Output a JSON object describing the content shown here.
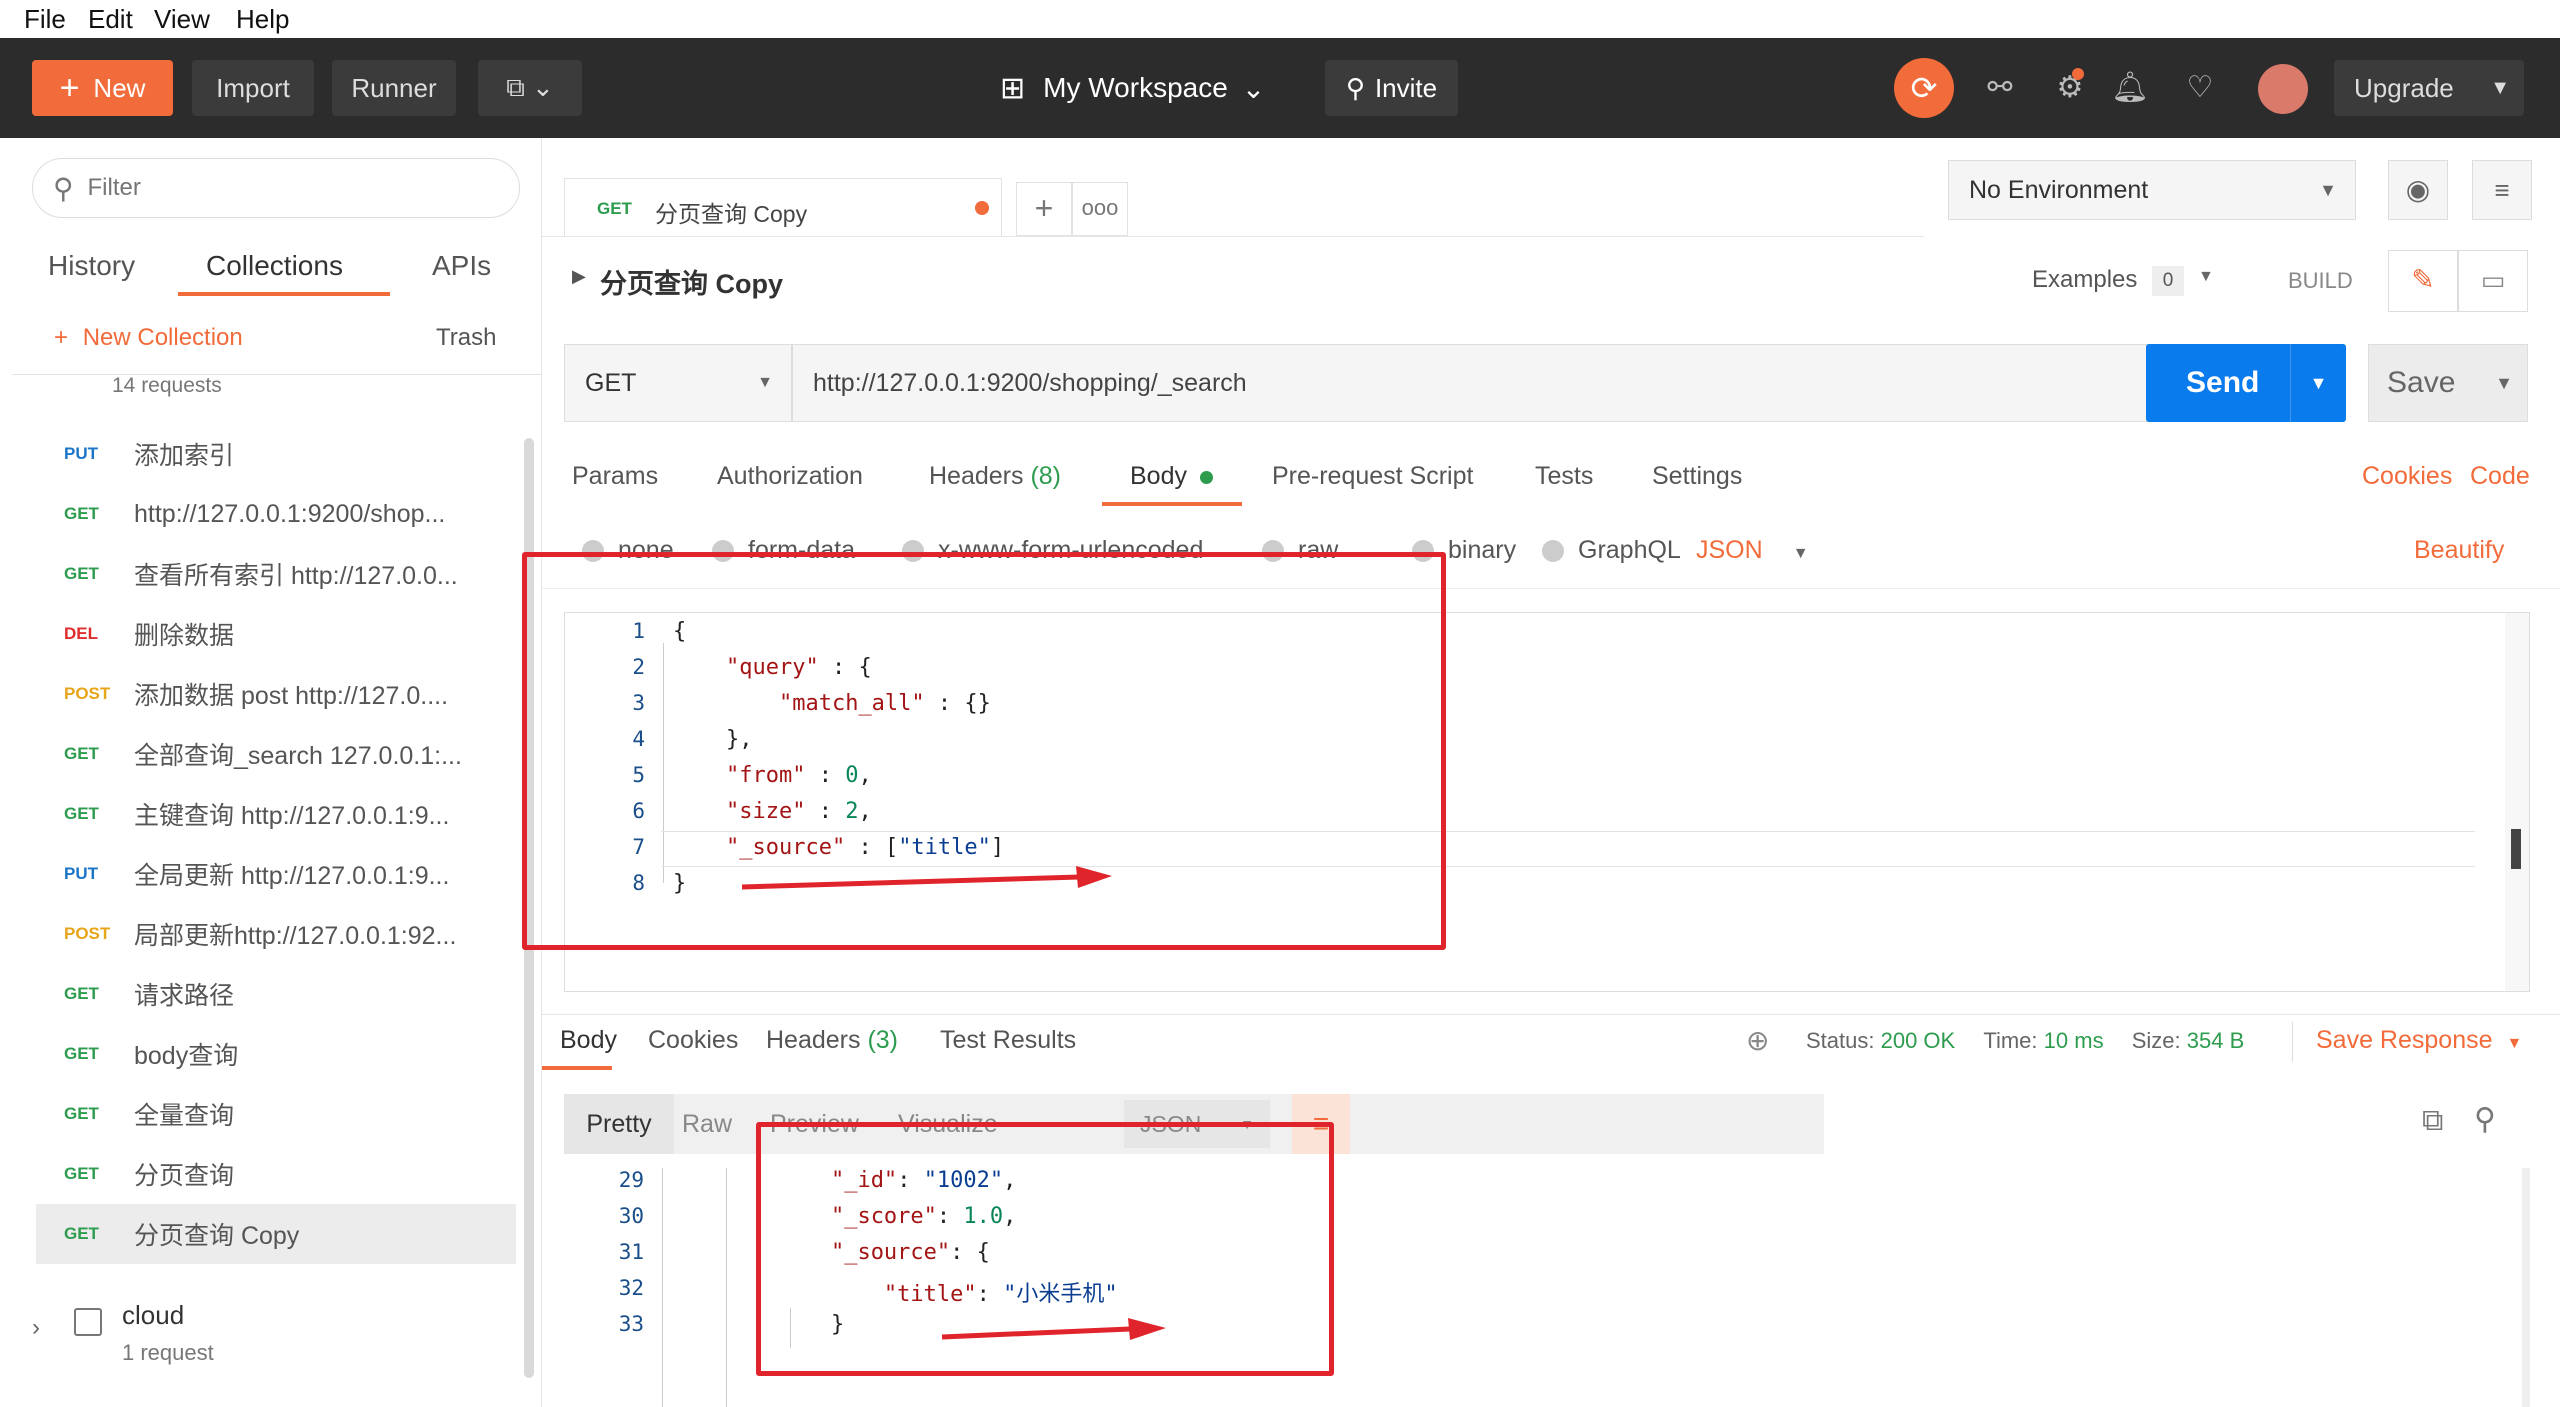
{
  "menu": [
    "File",
    "Edit",
    "View",
    "Help"
  ],
  "header": {
    "new_label": "New",
    "import_label": "Import",
    "runner_label": "Runner",
    "workspace_label": "My Workspace",
    "invite_label": "Invite",
    "upgrade_label": "Upgrade"
  },
  "sidebar": {
    "filter_placeholder": "Filter",
    "tabs": [
      "History",
      "Collections",
      "APIs"
    ],
    "new_collection": "New Collection",
    "trash": "Trash",
    "collection_count": "14 requests",
    "items": [
      {
        "method": "PUT",
        "label": "添加索引"
      },
      {
        "method": "GET",
        "label": "http://127.0.0.1:9200/shop..."
      },
      {
        "method": "GET",
        "label": "查看所有索引 http://127.0.0..."
      },
      {
        "method": "DEL",
        "label": "删除数据"
      },
      {
        "method": "POST",
        "label": "添加数据 post http://127.0...."
      },
      {
        "method": "GET",
        "label": "全部查询_search 127.0.0.1:..."
      },
      {
        "method": "GET",
        "label": "主键查询 http://127.0.0.1:9..."
      },
      {
        "method": "PUT",
        "label": "全局更新 http://127.0.0.1:9..."
      },
      {
        "method": "POST",
        "label": "局部更新http://127.0.0.1:92..."
      },
      {
        "method": "GET",
        "label": "请求路径"
      },
      {
        "method": "GET",
        "label": "body查询"
      },
      {
        "method": "GET",
        "label": "全量查询"
      },
      {
        "method": "GET",
        "label": "分页查询"
      },
      {
        "method": "GET",
        "label": "分页查询 Copy"
      }
    ],
    "cloud_name": "cloud",
    "cloud_count": "1 request"
  },
  "tab": {
    "method": "GET",
    "name": "分页查询 Copy"
  },
  "environment": "No Environment",
  "request": {
    "title": "分页查询 Copy",
    "examples_label": "Examples",
    "examples_count": "0",
    "build_label": "BUILD",
    "method": "GET",
    "url": "http://127.0.0.1:9200/shopping/_search",
    "send": "Send",
    "save": "Save",
    "tabs": [
      "Params",
      "Authorization",
      "Headers",
      "Body",
      "Pre-request Script",
      "Tests",
      "Settings"
    ],
    "headers_count": "(8)",
    "cookies": "Cookies",
    "code": "Code",
    "body_types": [
      "none",
      "form-data",
      "x-www-form-urlencoded",
      "raw",
      "binary",
      "GraphQL"
    ],
    "json_label": "JSON",
    "beautify": "Beautify",
    "body_lines": [
      {
        "n": "1",
        "t": "{"
      },
      {
        "n": "2",
        "t": "    \"query\" : {"
      },
      {
        "n": "3",
        "t": "        \"match_all\" : {}"
      },
      {
        "n": "4",
        "t": "    },"
      },
      {
        "n": "5",
        "t": "    \"from\" : 0,"
      },
      {
        "n": "6",
        "t": "    \"size\" : 2,"
      },
      {
        "n": "7",
        "t": "    \"_source\" : [\"title\"]"
      },
      {
        "n": "8",
        "t": "}"
      }
    ]
  },
  "response": {
    "tabs": [
      "Body",
      "Cookies",
      "Headers",
      "Test Results"
    ],
    "headers_count": "(3)",
    "status_label": "Status:",
    "status_value": "200 OK",
    "time_label": "Time:",
    "time_value": "10 ms",
    "size_label": "Size:",
    "size_value": "354 B",
    "save_response": "Save Response",
    "view_tabs": [
      "Pretty",
      "Raw",
      "Preview",
      "Visualize"
    ],
    "format": "JSON",
    "lines": [
      {
        "n": "29",
        "t": "            \"_id\": \"1002\","
      },
      {
        "n": "30",
        "t": "            \"_score\": 1.0,"
      },
      {
        "n": "31",
        "t": "            \"_source\": {"
      },
      {
        "n": "32",
        "t": "                \"title\": \"小米手机\""
      },
      {
        "n": "33",
        "t": "            }"
      }
    ]
  },
  "colors": {
    "accent": "#f26b3a",
    "send": "#097bed",
    "annotation": "#e0242b",
    "status_ok": "#2d9c4e"
  }
}
